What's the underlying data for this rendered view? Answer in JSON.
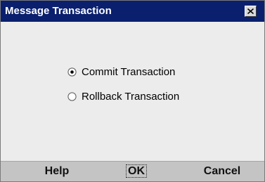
{
  "window": {
    "title": "Message Transaction"
  },
  "options": [
    {
      "label": "Commit Transaction",
      "selected": true
    },
    {
      "label": "Rollback Transaction",
      "selected": false
    }
  ],
  "buttons": {
    "help": "Help",
    "ok": "OK",
    "cancel": "Cancel"
  },
  "colors": {
    "titlebar": "#0a1f6e",
    "body": "#ececec",
    "button_bar": "#c4c4c4"
  },
  "icons": {
    "close": "close-icon"
  }
}
